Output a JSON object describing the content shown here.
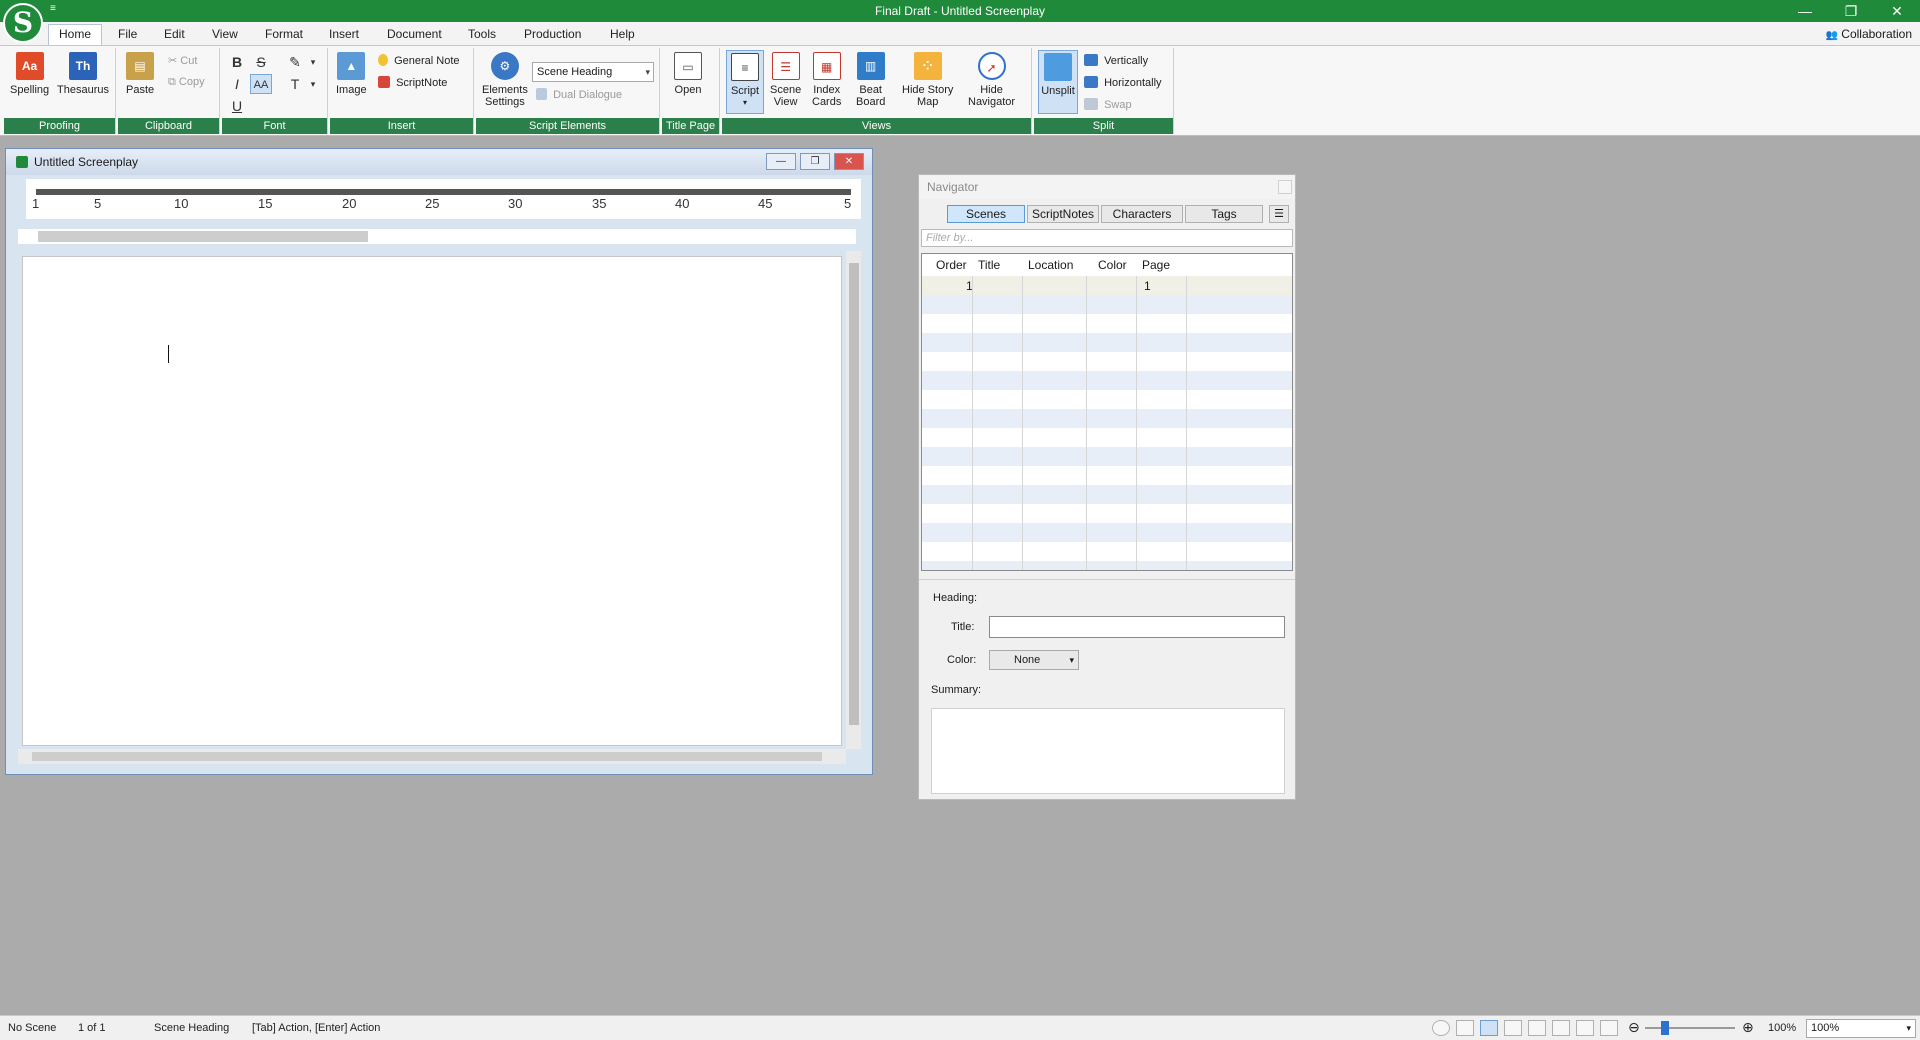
{
  "window": {
    "title": "Final Draft - Untitled Screenplay",
    "minimize": "—",
    "restore": "❐",
    "close": "✕",
    "quick_access": "≡"
  },
  "logo": {
    "letter": "S"
  },
  "menu": {
    "items": [
      "Home",
      "File",
      "Edit",
      "View",
      "Format",
      "Insert",
      "Document",
      "Tools",
      "Production",
      "Help"
    ],
    "active": "Home",
    "collaboration": "Collaboration"
  },
  "ribbon": {
    "proofing": {
      "label": "Proofing",
      "spelling": "Spelling",
      "thesaurus": "Thesaurus",
      "spelling_icon": "Aa",
      "thesaurus_icon": "Th"
    },
    "clipboard": {
      "label": "Clipboard",
      "paste": "Paste",
      "cut": "Cut",
      "copy": "Copy"
    },
    "font": {
      "label": "Font",
      "bold": "B",
      "strike": "S",
      "italic": "I",
      "caps": "AA",
      "underline": "U",
      "highlight": "✎",
      "textcolor": "T",
      "caret": "▾"
    },
    "insert": {
      "label": "Insert",
      "image": "Image",
      "general_note": "General Note",
      "scriptnote": "ScriptNote"
    },
    "script_elements": {
      "label": "Script Elements",
      "settings_line1": "Elements",
      "settings_line2": "Settings",
      "element_value": "Scene Heading",
      "dual_dialogue": "Dual Dialogue"
    },
    "title_page": {
      "label": "Title Page",
      "open": "Open"
    },
    "views": {
      "label": "Views",
      "script": "Script",
      "scene_view_1": "Scene",
      "scene_view_2": "View",
      "index_cards_1": "Index",
      "index_cards_2": "Cards",
      "beat_board_1": "Beat",
      "beat_board_2": "Board",
      "hide_story_map_1": "Hide Story",
      "hide_story_map_2": "Map",
      "hide_navigator_1": "Hide",
      "hide_navigator_2": "Navigator"
    },
    "split": {
      "label": "Split",
      "unsplit": "Unsplit",
      "vertically": "Vertically",
      "horizontally": "Horizontally",
      "swap": "Swap"
    }
  },
  "document": {
    "title": "Untitled Screenplay",
    "ruler_marks": [
      "1",
      "5",
      "10",
      "15",
      "20",
      "25",
      "30",
      "35",
      "40",
      "45",
      "5"
    ]
  },
  "navigator": {
    "title": "Navigator",
    "tabs": [
      "Scenes",
      "ScriptNotes",
      "Characters",
      "Tags"
    ],
    "active_tab": "Scenes",
    "filter_placeholder": "Filter by...",
    "columns": [
      "Order",
      "Title",
      "Location",
      "Color",
      "Page"
    ],
    "rows": [
      {
        "order": "1",
        "title": "",
        "location": "",
        "color": "",
        "page": "1"
      }
    ],
    "details": {
      "heading_label": "Heading:",
      "title_label": "Title:",
      "color_label": "Color:",
      "color_value": "None",
      "summary_label": "Summary:"
    }
  },
  "status": {
    "scene": "No Scene",
    "page": "1  of  1",
    "element": "Scene Heading",
    "hint": "[Tab]  Action,  [Enter] Action",
    "zoom_label": "100%",
    "zoom_value": "100%"
  },
  "colors": {
    "titlebar": "#1f8a3a",
    "ribbon_group_label": "#2a7f4a",
    "accent": "#2f6fcf"
  }
}
